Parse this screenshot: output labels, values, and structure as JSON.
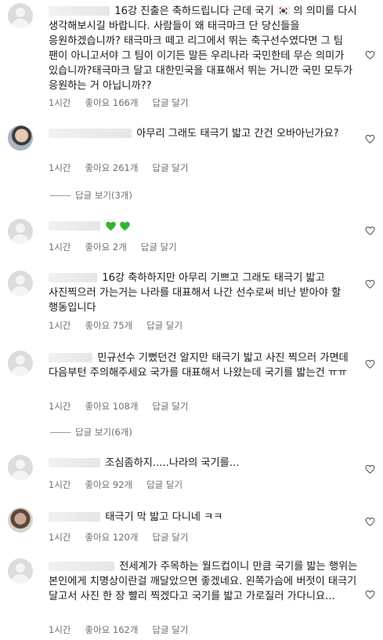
{
  "comments": [
    {
      "text": "16강 진출은 축하드립니다 근데 국기 🇰🇷 의 의미를 다시 생각해보시길 바랍니다. 사람들이 왜 태극마크 단 당신들을 응원하겠습니까? 태극마크 떼고 리그에서 뛰는 축구선수였다면 그 팀 팬이 아니고서야 그 팀이 이기든 말든 우리나라 국민한테 무슨 의미가 있습니까?태극마크 달고 대한민국을 대표해서 뛰는 거니깐 국민 모두가 응원하는 거 아닙니까??",
      "time": "1시간",
      "likes": "좋아요 166개",
      "reply": "답글 달기"
    },
    {
      "text": "아무리 그래도 태극기 밟고 간건 오바아닌가요?",
      "time": "1시간",
      "likes": "좋아요 261개",
      "reply": "답글 달기",
      "view_replies": "답글 보기(3개)"
    },
    {
      "text": "",
      "time": "1시간",
      "likes": "좋아요 2개",
      "reply": "답글 달기"
    },
    {
      "text": "16강 축하하지만 아무리 기쁘고 그래도 태극기 밟고 사진찍으러 가는거는 나라를 대표해서 나간 선수로써 비난 받아야 할 행동입니다",
      "time": "1시간",
      "likes": "좋아요 75개",
      "reply": "답글 달기"
    },
    {
      "text": "민규선수 기뻤던건 알지만 태극기 밟고 사진 찍으러 가면데 다음부턴 주의해주세요 국가를 대표해서 나왔는데 국기를 밟는건 ㅠㅠ",
      "time": "1시간",
      "likes": "좋아요 108개",
      "reply": "답글 달기",
      "view_replies": "답글 보기(6개)"
    },
    {
      "text": "조심좀하지.....나라의 국기를...",
      "time": "1시간",
      "likes": "좋아요 92개",
      "reply": "답글 달기"
    },
    {
      "text": "태극기 막 밟고 다니네 ㅋㅋ",
      "time": "1시간",
      "likes": "좋아요 120개",
      "reply": "답글 달기"
    },
    {
      "text": "전세계가 주목하는 월드컵이니 만큼 국기를 밟는 행위는 본인에게 치명상이란걸 깨달았으면 좋겠네요. 왼쪽가슴에 버젓이 태극기 달고서 사진 한 장 빨리 찍겠다고 국기를 밟고 가로질러 가다니요...",
      "time": "1시간",
      "likes": "좋아요 162개",
      "reply": "답글 달기"
    }
  ],
  "icons": {
    "like": "heart-outline-icon",
    "green_hearts": "green-heart-icon",
    "heart_color": "#2fb52f"
  }
}
